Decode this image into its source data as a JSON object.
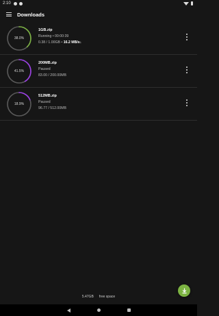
{
  "status_bar": {
    "time": "2:10"
  },
  "app_bar": {
    "title": "Downloads"
  },
  "downloads": [
    {
      "percent_label": "38.0%",
      "progress": 0.38,
      "color": "#7cb342",
      "name": "1GB.zip",
      "state": "Running",
      "eta": "00:00:39",
      "size": "0.38 / 1.00GB",
      "speed": "16.2 MB/s"
    },
    {
      "percent_label": "41.5%",
      "progress": 0.415,
      "color": "#9c3fe6",
      "name": "200MB.zip",
      "state": "Paused",
      "size": "83.00 / 200.00MB"
    },
    {
      "percent_label": "18.9%",
      "progress": 0.189,
      "color": "#9c3fe6",
      "name": "512MB.zip",
      "state": "Paused",
      "size": "96.77 / 512.00MB"
    }
  ],
  "footer": {
    "free_value": "5.47GB",
    "free_label": "free space"
  },
  "colors": {
    "fab": "#7cb342",
    "running": "#7cb342",
    "paused": "#9c3fe6"
  }
}
